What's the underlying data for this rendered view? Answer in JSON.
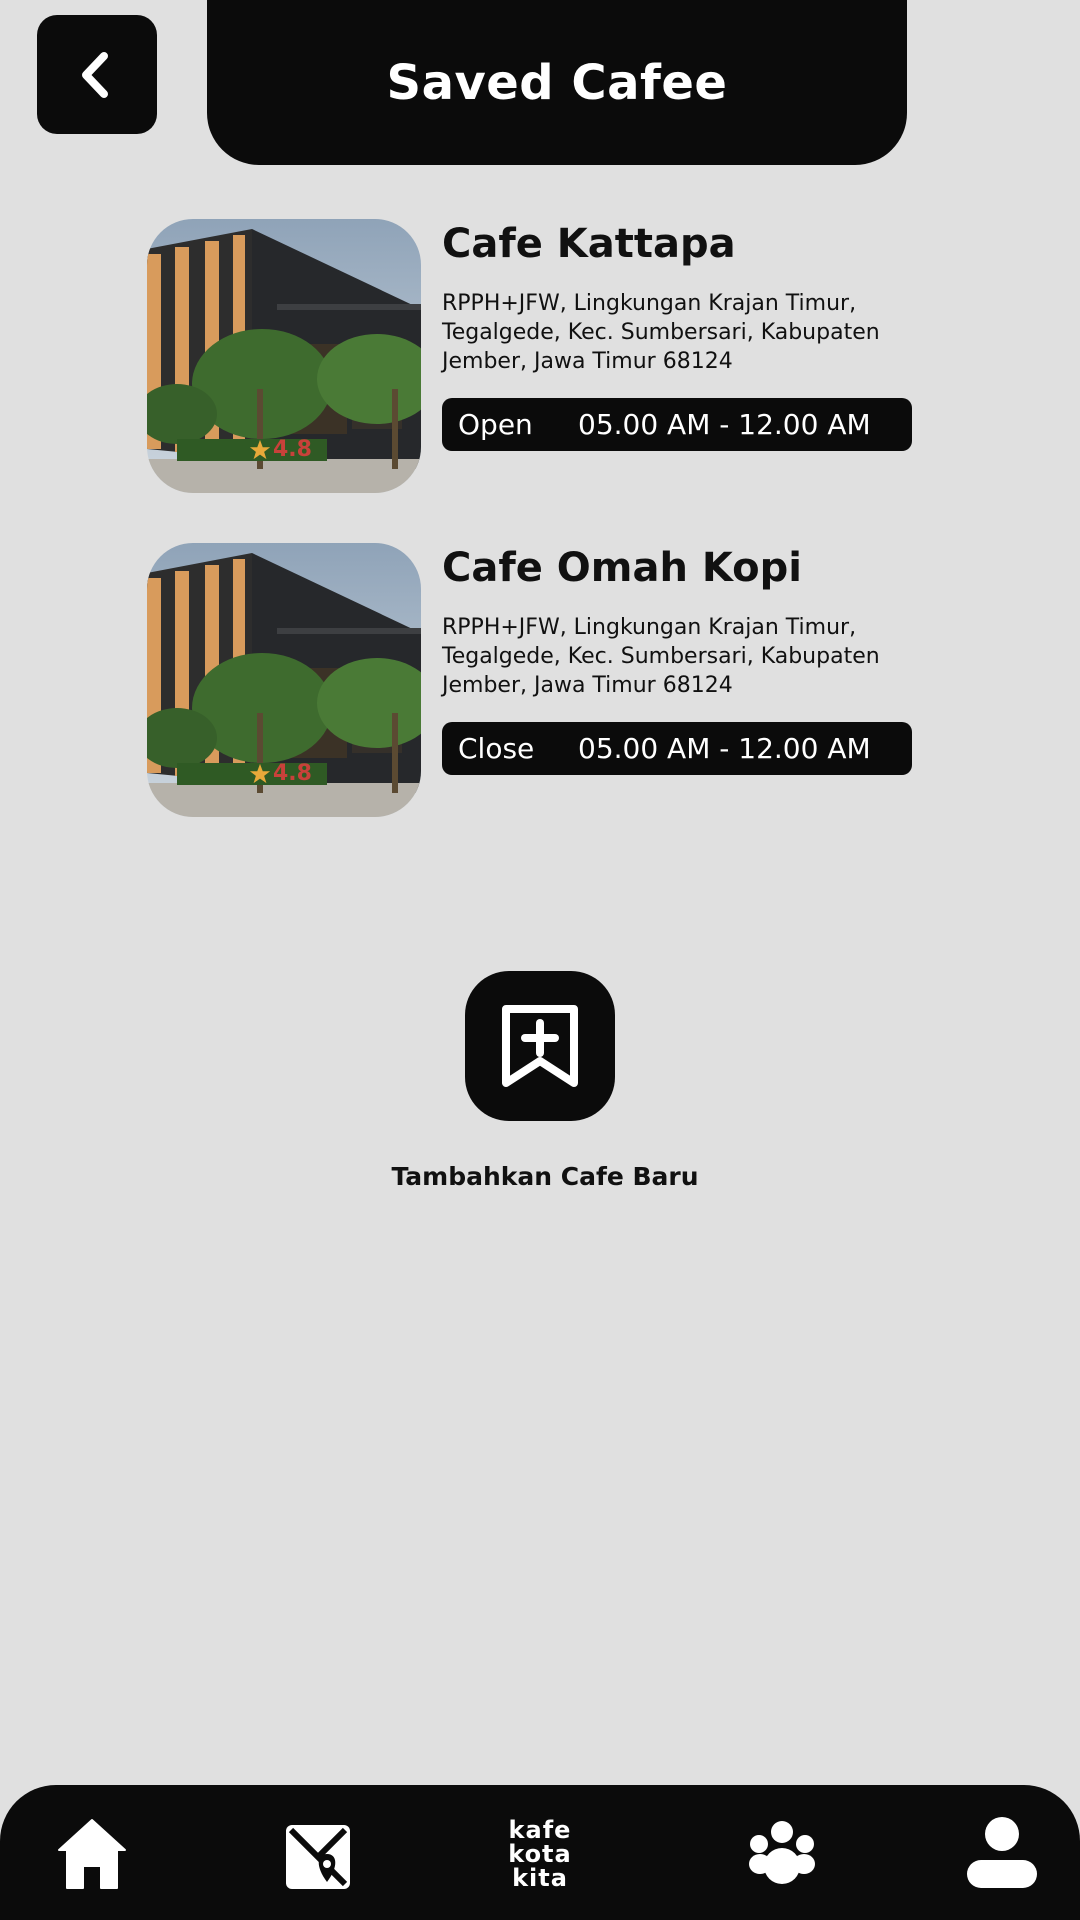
{
  "header": {
    "title": "Saved Cafee",
    "back_icon": "chevron-left-icon"
  },
  "cafes": [
    {
      "name": "Cafe Kattapa",
      "address": "RPPH+JFW, Lingkungan Krajan Timur, Tegalgede, Kec. Sumbersari, Kabupaten Jember, Jawa Timur 68124",
      "rating": "4.8",
      "status": "Open",
      "hours": "05.00 AM - 12.00 AM"
    },
    {
      "name": "Cafe Omah Kopi",
      "address": "RPPH+JFW, Lingkungan Krajan Timur, Tegalgede, Kec. Sumbersari, Kabupaten Jember, Jawa Timur 68124",
      "rating": "4.8",
      "status": "Close",
      "hours": "05.00 AM - 12.00 AM"
    }
  ],
  "add_cafe": {
    "label": "Tambahkan Cafe Baru",
    "icon": "bookmark-plus-icon"
  },
  "bottom_nav": {
    "items": [
      {
        "icon": "home-icon"
      },
      {
        "icon": "map-icon"
      },
      {
        "logo_lines": [
          "kafe",
          "kota",
          "kita"
        ]
      },
      {
        "icon": "community-icon"
      },
      {
        "icon": "profile-icon"
      }
    ]
  },
  "colors": {
    "background": "#e0e0e0",
    "dark": "#0b0b0b",
    "rating": "#c8413a",
    "star": "#e8a93a"
  }
}
